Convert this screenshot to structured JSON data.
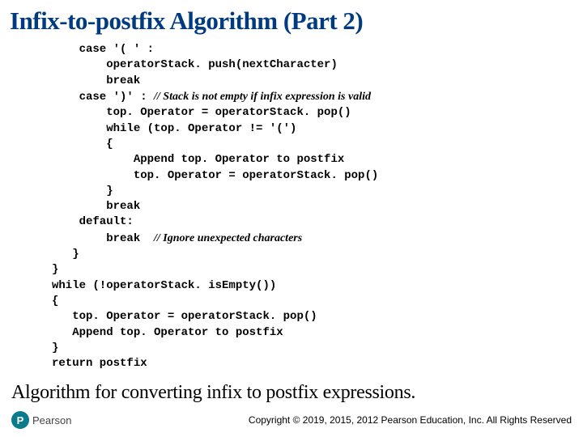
{
  "title": "Infix-to-postfix Algorithm (Part 2)",
  "code": {
    "l1": "    case '( ' :",
    "l2": "        operatorStack. push(nextCharacter)",
    "l3": "        break",
    "l4a": "    case ')' : ",
    "l4b": "// Stack is not empty if infix expression is valid",
    "l5": "        top. Operator = operatorStack. pop()",
    "l6": "        while (top. Operator != '(')",
    "l7": "        {",
    "l8": "            Append top. Operator to postfix",
    "l9": "            top. Operator = operatorStack. pop()",
    "l10": "        }",
    "l11": "        break",
    "l12": "    default:",
    "l13a": "        break  ",
    "l13b": "// Ignore unexpected characters",
    "l14": "   }",
    "l15": "}",
    "l16": "while (!operatorStack. isEmpty())",
    "l17": "{",
    "l18": "   top. Operator = operatorStack. pop()",
    "l19": "   Append top. Operator to postfix",
    "l20": "}",
    "l21": "return postfix"
  },
  "caption": "Algorithm for converting infix to  postfix expressions.",
  "footer": {
    "logo_letter": "P",
    "logo_text": "Pearson",
    "copyright": "Copyright © 2019, 2015, 2012 Pearson Education, Inc. All Rights Reserved"
  }
}
